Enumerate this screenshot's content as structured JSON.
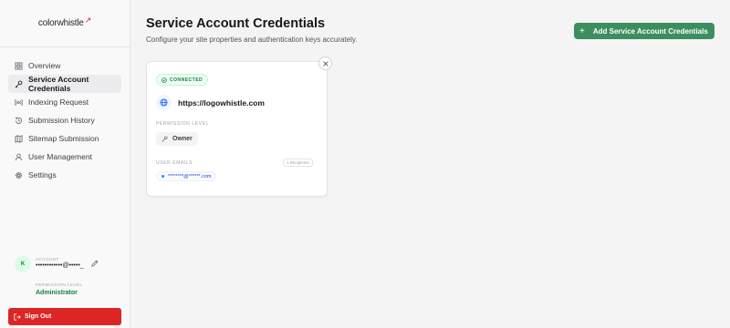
{
  "brand": {
    "logo_text": "colorwhistle",
    "logo_mark": "↗"
  },
  "sidebar": {
    "items": [
      {
        "label": "Overview",
        "icon": "grid-icon"
      },
      {
        "label": "Service Account Credentials",
        "icon": "key-icon",
        "active": true
      },
      {
        "label": "Indexing Request",
        "icon": "broadcast-icon"
      },
      {
        "label": "Submission History",
        "icon": "history-icon"
      },
      {
        "label": "Sitemap Submission",
        "icon": "map-icon"
      },
      {
        "label": "User Management",
        "icon": "users-icon"
      },
      {
        "label": "Settings",
        "icon": "gear-icon"
      }
    ]
  },
  "account": {
    "avatar_initial": "K",
    "account_label": "ACCOUNT",
    "account_value": "••••••••••••@•••••_",
    "permission_label": "PERMISSION LEVEL",
    "permission_value": "Administrator"
  },
  "signout_label": "Sign Out",
  "header": {
    "title": "Service Account Credentials",
    "subtitle": "Configure your site properties and authentication keys accurately.",
    "add_button_label": "Add Service Account Credentials"
  },
  "credential_card": {
    "status": "CONNECTED",
    "site_url": "https://logowhistle.com",
    "permission_label": "PERMISSION LEVEL",
    "permission_value": "Owner",
    "emails_label": "USER EMAILS",
    "recipients_badge": "1 Recipients",
    "emails": [
      "********@******.com"
    ]
  },
  "colors": {
    "accent_green": "#3d8e5f",
    "danger_red": "#dc2626",
    "status_green": "#15803d"
  }
}
